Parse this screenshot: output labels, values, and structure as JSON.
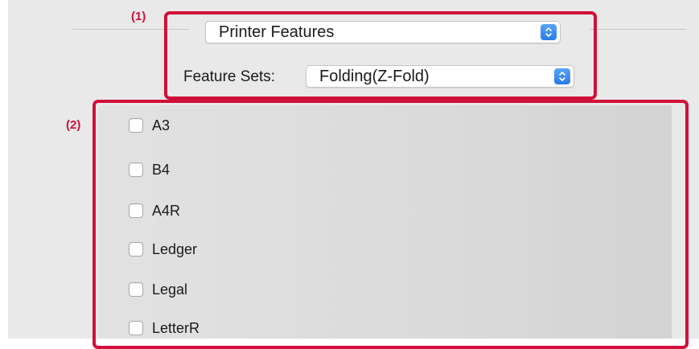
{
  "callouts": {
    "label_1": "(1)",
    "label_2": "(2)"
  },
  "panel_popup": {
    "value": "Printer Features"
  },
  "feature_sets": {
    "label": "Feature Sets:",
    "value": "Folding(Z-Fold)"
  },
  "options": [
    {
      "label": "A3",
      "checked": false
    },
    {
      "label": "B4",
      "checked": false
    },
    {
      "label": "A4R",
      "checked": false
    },
    {
      "label": "Ledger",
      "checked": false
    },
    {
      "label": "Legal",
      "checked": false
    },
    {
      "label": "LetterR",
      "checked": false
    }
  ],
  "colors": {
    "callout": "#d0103a",
    "stepper": "#2a7be8"
  }
}
